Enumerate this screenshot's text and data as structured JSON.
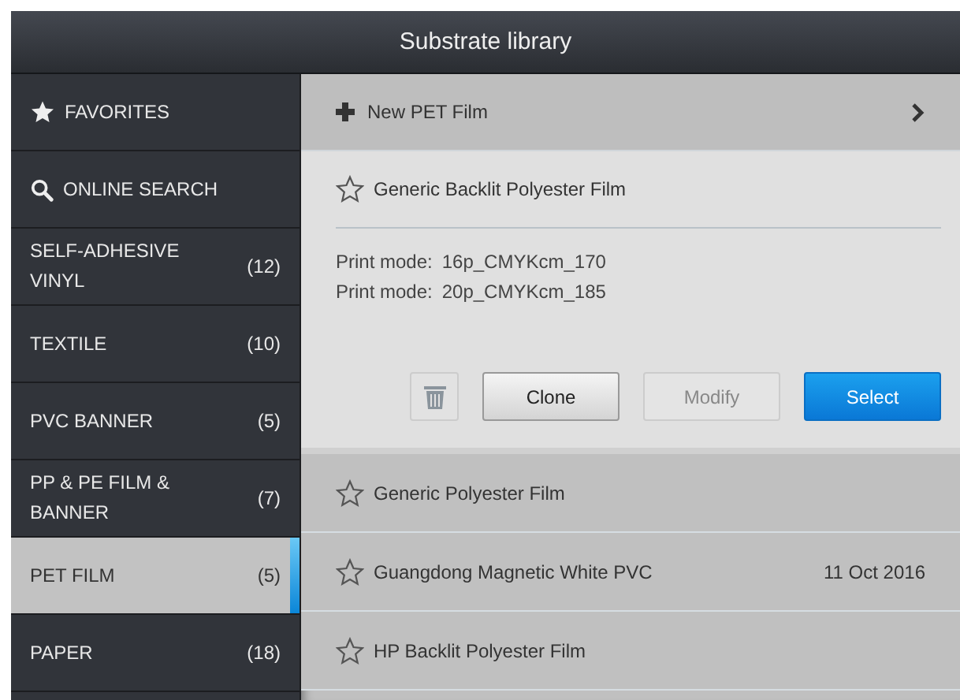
{
  "window": {
    "title": "Substrate library"
  },
  "sidebar": {
    "items": [
      {
        "kind": "favorites",
        "label": "FAVORITES",
        "selected": false
      },
      {
        "kind": "search",
        "label": "ONLINE SEARCH",
        "selected": false
      },
      {
        "kind": "category",
        "label": "SELF-ADHESIVE VINYL",
        "count": "(12)",
        "selected": false
      },
      {
        "kind": "category",
        "label": "TEXTILE",
        "count": "(10)",
        "selected": false
      },
      {
        "kind": "category",
        "label": "PVC BANNER",
        "count": "(5)",
        "selected": false
      },
      {
        "kind": "category",
        "label": "PP & PE FILM & BANNER",
        "count": "(7)",
        "selected": false
      },
      {
        "kind": "category",
        "label": "PET FILM",
        "count": "(5)",
        "selected": true
      },
      {
        "kind": "category",
        "label": "PAPER",
        "count": "(18)",
        "selected": false
      }
    ]
  },
  "new_item": {
    "label": "New PET Film"
  },
  "substrates": [
    {
      "name": "Generic Backlit Polyester Film",
      "favorite": false,
      "expanded": true,
      "print_modes": [
        {
          "label": "Print mode:",
          "value": "16p_CMYKcm_170"
        },
        {
          "label": "Print mode:",
          "value": "20p_CMYKcm_185"
        }
      ],
      "actions": [
        {
          "kind": "delete",
          "disabled": false
        },
        {
          "kind": "normal",
          "label": "Clone",
          "disabled": false
        },
        {
          "kind": "normal",
          "label": "Modify",
          "disabled": true
        },
        {
          "kind": "primary",
          "label": "Select",
          "disabled": false
        }
      ]
    },
    {
      "name": "Generic Polyester Film",
      "favorite": false,
      "expanded": false
    },
    {
      "name": "Guangdong Magnetic White PVC",
      "favorite": false,
      "expanded": false,
      "date": "11 Oct 2016"
    },
    {
      "name": "HP Backlit Polyester Film",
      "favorite": false,
      "expanded": false
    }
  ]
}
